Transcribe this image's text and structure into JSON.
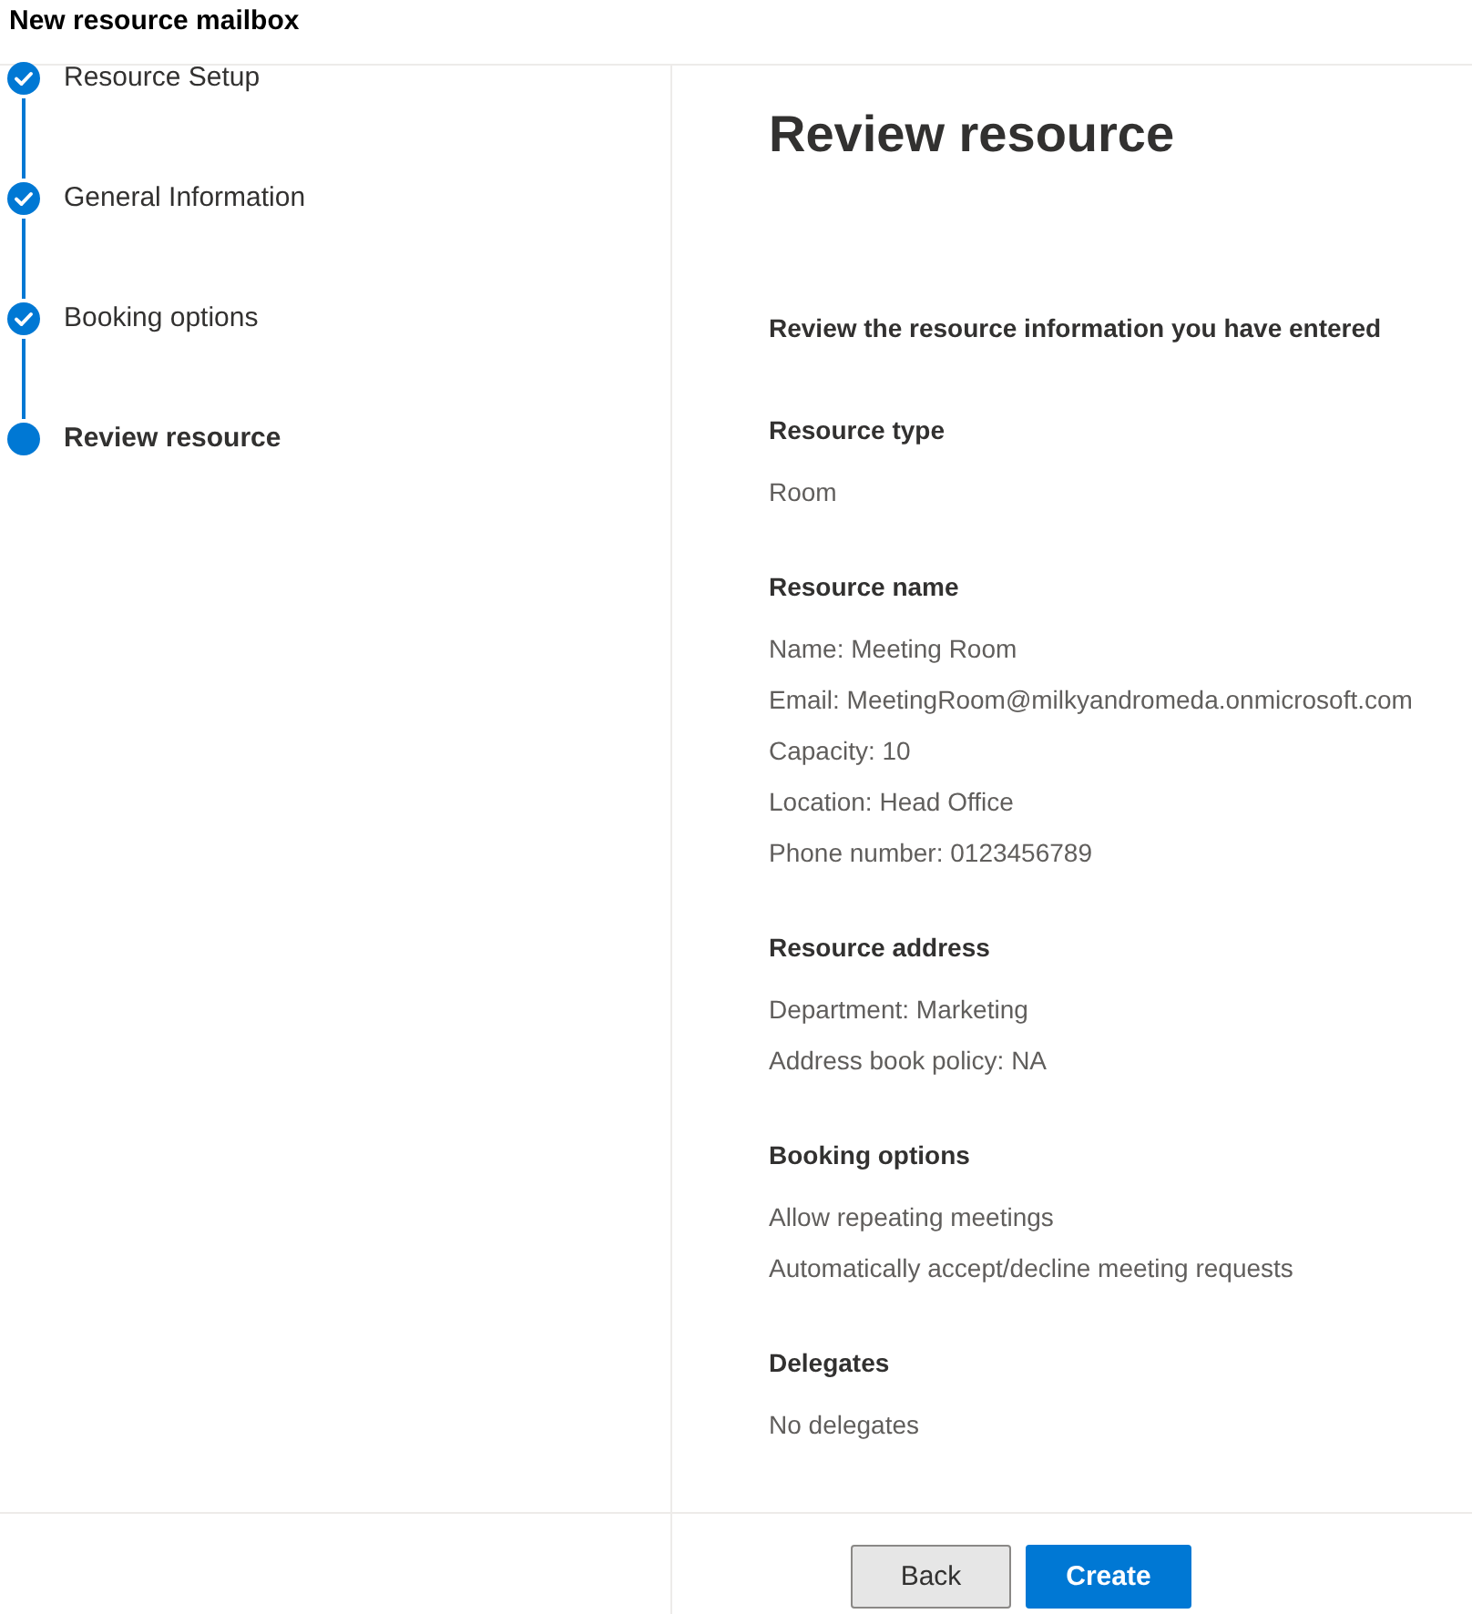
{
  "dialog": {
    "title": "New resource mailbox"
  },
  "steps": [
    {
      "label": "Resource Setup",
      "completed": true,
      "selected": false
    },
    {
      "label": "General Information",
      "completed": true,
      "selected": false
    },
    {
      "label": "Booking options",
      "completed": true,
      "selected": false
    },
    {
      "label": "Review resource",
      "completed": false,
      "selected": true
    }
  ],
  "review": {
    "heading": "Review resource",
    "intro": "Review the resource information you have entered",
    "sections": [
      {
        "title": "Resource type",
        "lines": [
          "Room"
        ]
      },
      {
        "title": "Resource name",
        "lines": [
          "Name: Meeting Room",
          "Email: MeetingRoom@milkyandromeda.onmicrosoft.com",
          "Capacity: 10",
          "Location: Head Office",
          "Phone number: 0123456789"
        ]
      },
      {
        "title": "Resource address",
        "lines": [
          "Department: Marketing",
          "Address book policy: NA"
        ]
      },
      {
        "title": "Booking options",
        "lines": [
          "Allow repeating meetings",
          "Automatically accept/decline meeting requests"
        ]
      },
      {
        "title": "Delegates",
        "lines": [
          "No delegates"
        ]
      }
    ]
  },
  "buttons": [
    {
      "label": "Back",
      "kind": "secondary"
    },
    {
      "label": "Create",
      "kind": "primary"
    }
  ]
}
